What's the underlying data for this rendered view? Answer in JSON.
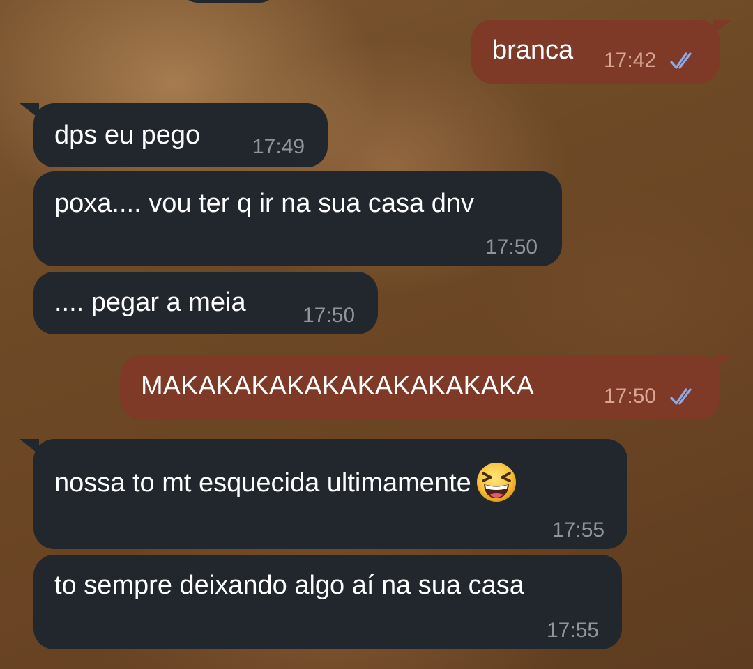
{
  "chat": {
    "messages": [
      {
        "direction": "outgoing",
        "text": "branca",
        "time": "17:42",
        "status": "read"
      },
      {
        "direction": "incoming",
        "text": "dps eu pego",
        "time": "17:49"
      },
      {
        "direction": "incoming",
        "text": "poxa.... vou ter q ir na sua casa dnv",
        "time": "17:50"
      },
      {
        "direction": "incoming",
        "text": ".... pegar a meia",
        "time": "17:50"
      },
      {
        "direction": "outgoing",
        "text": "MAKAKAKAKAKAKAKAKAKAKA",
        "time": "17:50",
        "status": "read"
      },
      {
        "direction": "incoming",
        "text": "nossa to mt esquecida ultimamente",
        "time": "17:55",
        "emoji": "grinning-squinting-face"
      },
      {
        "direction": "incoming",
        "text": "to sempre deixando algo aí na sua casa",
        "time": "17:55"
      }
    ]
  },
  "colors": {
    "incoming_bubble": "#22272d",
    "outgoing_bubble": "#7e3a27",
    "read_checks": "#8ea9e6"
  }
}
